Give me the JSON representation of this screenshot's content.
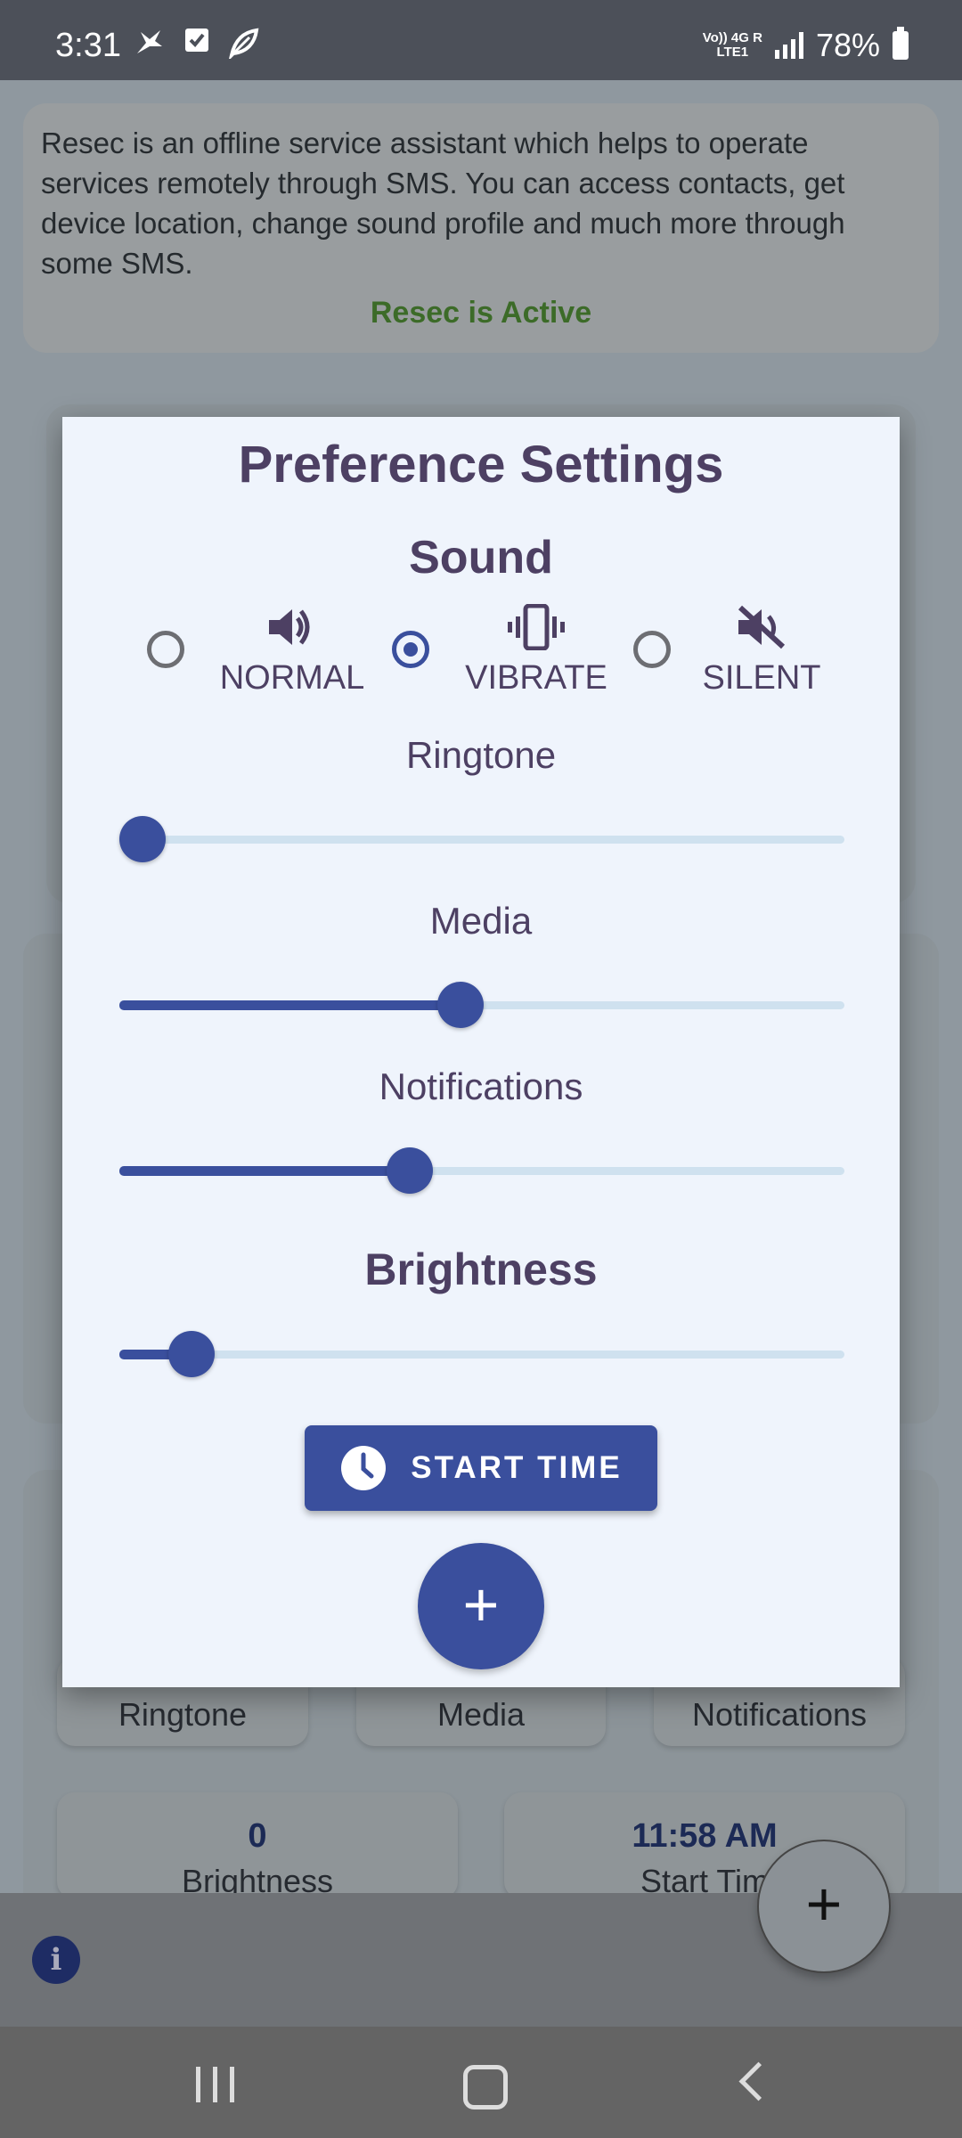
{
  "status_bar": {
    "time": "3:31",
    "network_top": "Vo)) 4G R",
    "network_bottom": "LTE1",
    "battery": "78%"
  },
  "background": {
    "info_text": "Resec is an offline service assistant which helps to operate services remotely through SMS. You can access contacts, get device location, change sound profile and much more through some SMS.",
    "status_text": "Resec is Active",
    "chips": {
      "ringtone": "Ringtone",
      "media": "Media",
      "notifications": "Notifications",
      "brightness_value": "0",
      "brightness_label": "Brightness",
      "start_time_value": "11:58 AM",
      "start_time_label": "Start Tim"
    },
    "fab_label": "+",
    "info_icon_label": "i"
  },
  "dialog": {
    "title": "Preference Settings",
    "sound_title": "Sound",
    "modes": [
      {
        "label": "NORMAL",
        "icon": "volume-up-icon",
        "selected": false
      },
      {
        "label": "VIBRATE",
        "icon": "vibrate-icon",
        "selected": true
      },
      {
        "label": "SILENT",
        "icon": "volume-off-icon",
        "selected": false
      }
    ],
    "sliders": {
      "ringtone": {
        "label": "Ringtone",
        "value": 0.0
      },
      "media": {
        "label": "Media",
        "value": 0.47
      },
      "notifications": {
        "label": "Notifications",
        "value": 0.4
      },
      "brightness": {
        "label": "Brightness",
        "value": 0.1
      }
    },
    "start_time_label": "START TIME",
    "add_label": "+"
  },
  "colors": {
    "accent": "#3a4f9d",
    "title": "#4d4063",
    "active_status": "#3c6b28"
  }
}
